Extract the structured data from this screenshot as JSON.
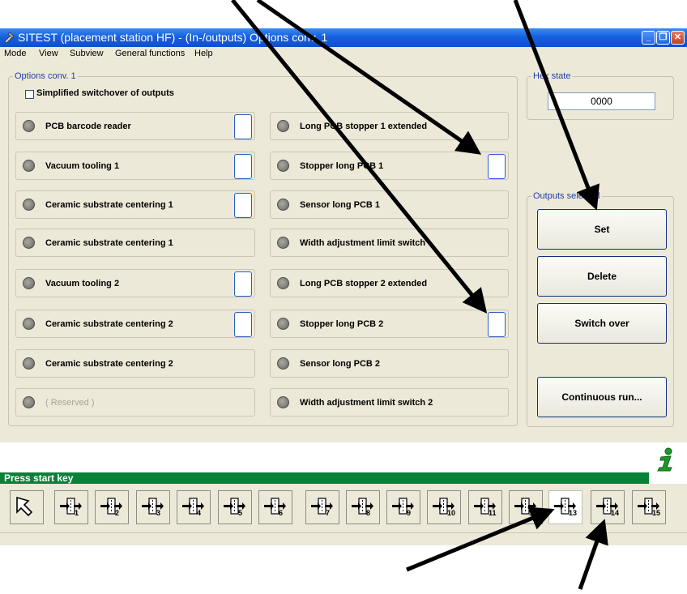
{
  "window": {
    "title": "SITEST (placement station HF) - (In-/outputs) Options conv. 1"
  },
  "menu": [
    "Mode",
    "View",
    "Subview",
    "General functions",
    "Help"
  ],
  "options": {
    "group_title": "Options conv. 1",
    "checkbox_label": "Simplified switchover of outputs",
    "left": [
      {
        "label": "PCB barcode reader",
        "button": true
      },
      {
        "label": "Vacuum tooling 1",
        "button": true
      },
      {
        "label": "Ceramic substrate centering 1",
        "button": true
      },
      {
        "label": "Ceramic substrate centering 1",
        "button": false
      },
      {
        "label": "Vacuum tooling 2",
        "button": true
      },
      {
        "label": "Ceramic substrate centering 2",
        "button": true
      },
      {
        "label": "Ceramic substrate centering 2",
        "button": false
      },
      {
        "label": "( Reserved )",
        "button": false,
        "disabled": true
      }
    ],
    "right": [
      {
        "label": "Long PCB stopper 1 extended",
        "button": false
      },
      {
        "label": "Stopper long PCB 1",
        "button": true
      },
      {
        "label": "Sensor long PCB 1",
        "button": false
      },
      {
        "label": "Width adjustment limit switch",
        "button": false
      },
      {
        "label": "Long PCB stopper 2 extended",
        "button": false
      },
      {
        "label": "Stopper long PCB 2",
        "button": true
      },
      {
        "label": "Sensor long PCB 2",
        "button": false
      },
      {
        "label": "Width adjustment limit switch 2",
        "button": false
      }
    ]
  },
  "hex": {
    "title": "Hex state",
    "value": "0000"
  },
  "outputs": {
    "title": "Outputs selected",
    "buttons": [
      "Set",
      "Delete",
      "Switch over"
    ],
    "continuous": "Continuous run..."
  },
  "status": {
    "text": "Press start key"
  },
  "toolbar": {
    "buttons": [
      "1",
      "2",
      "3",
      "4",
      "5",
      "6",
      "7",
      "8",
      "9",
      "10",
      "11",
      "12",
      "13",
      "14",
      "15"
    ],
    "active": "13"
  },
  "colors": {
    "title_bar": "#1660e0",
    "status_bar": "#098238",
    "legend_text": "#1f3ea8",
    "info_icon": "#1c9b2a"
  }
}
